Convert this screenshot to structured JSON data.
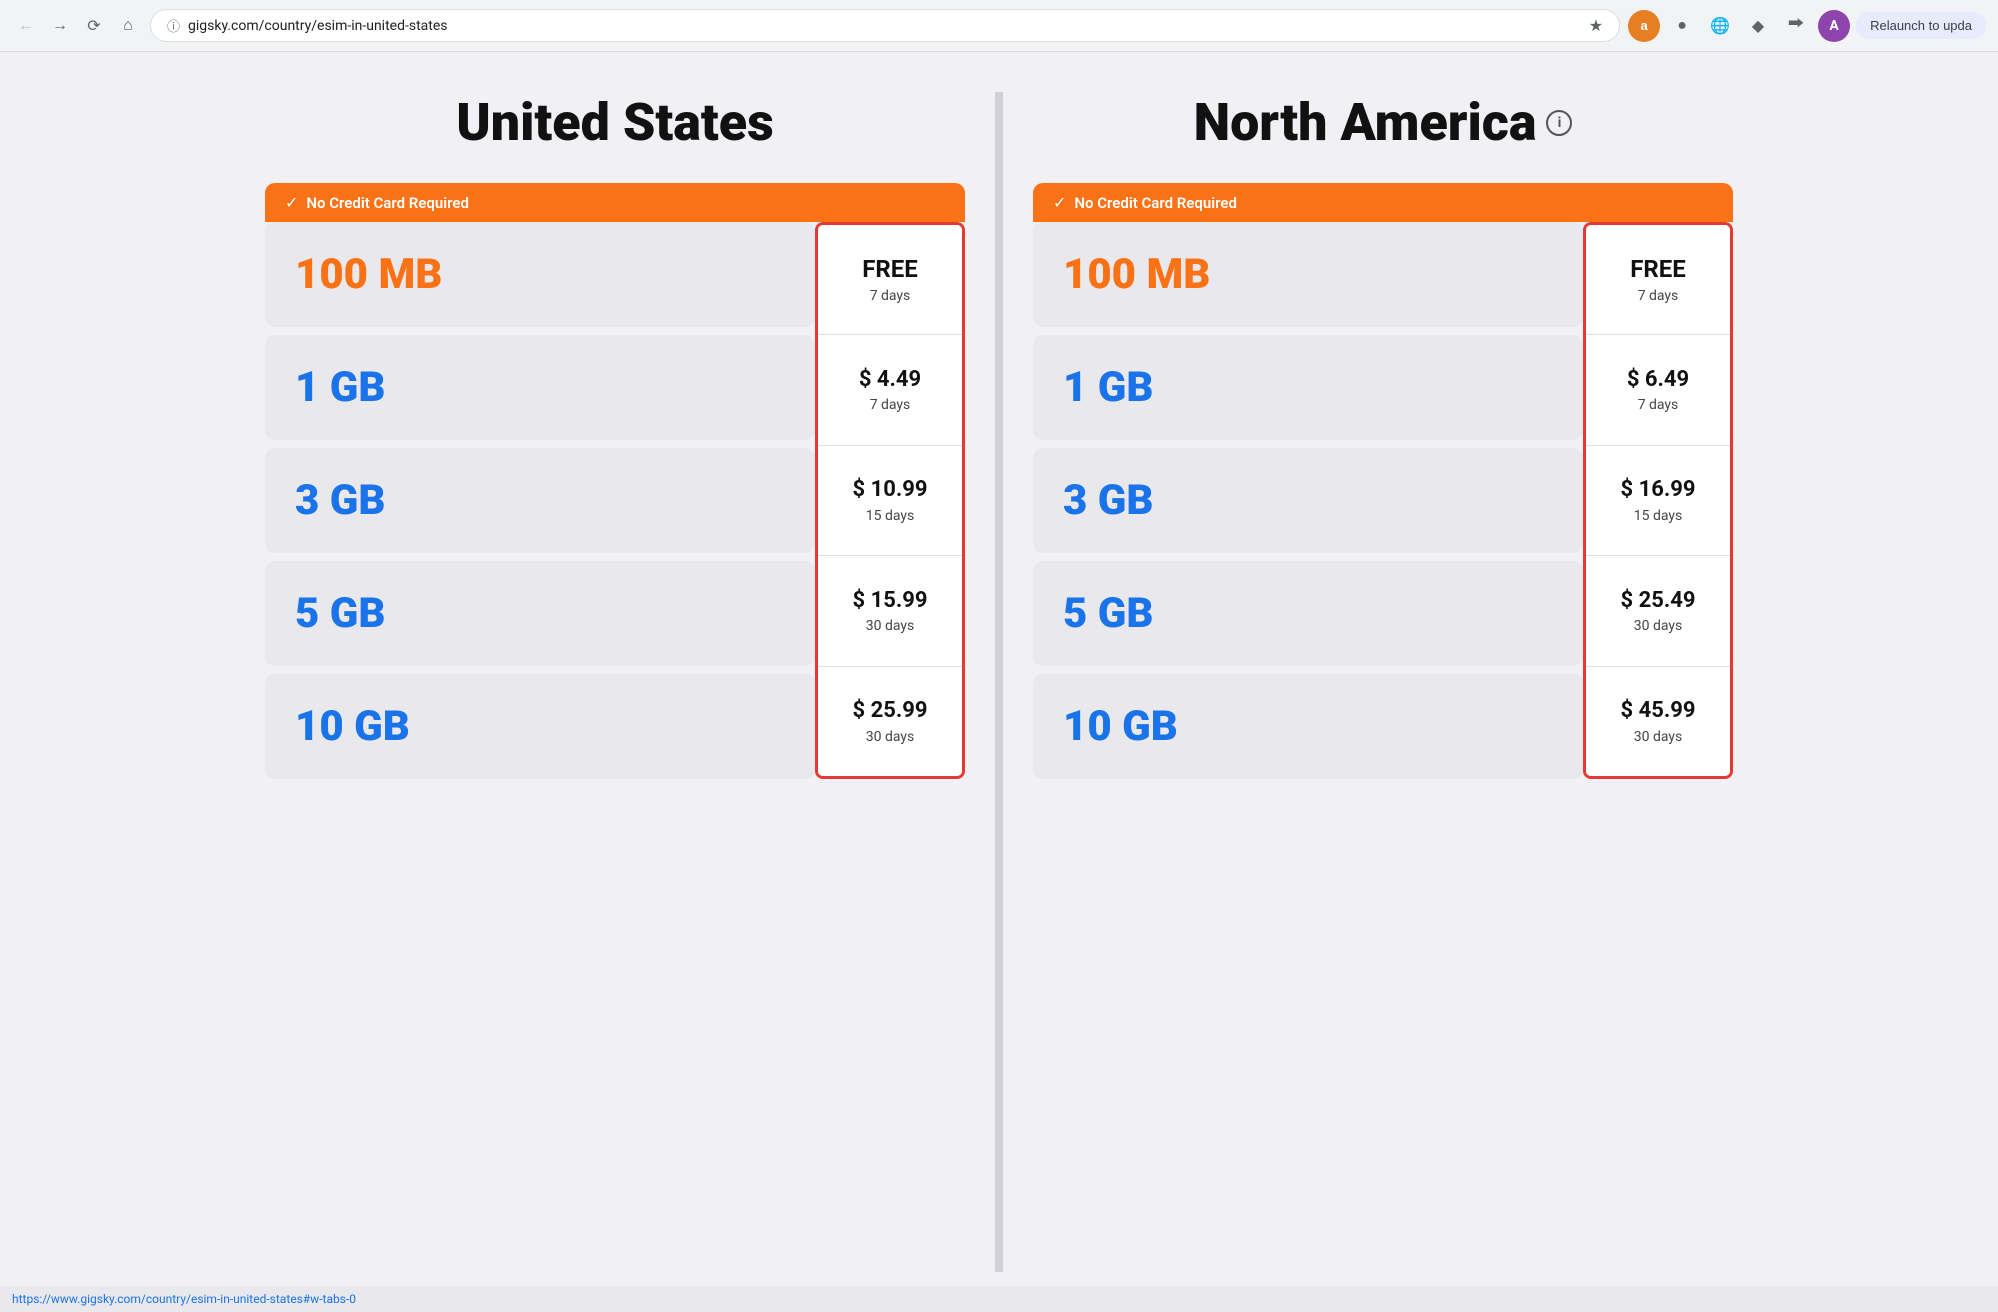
{
  "browser": {
    "url": "gigsky.com/country/esim-in-united-states",
    "relaunch_label": "Relaunch to upda",
    "avatar_letter": "A",
    "status_url": "https://www.gigsky.com/country/esim-in-united-states#w-tabs-0"
  },
  "sections": [
    {
      "id": "us",
      "title": "United States",
      "show_info": false,
      "no_credit_card": "No Credit Card Required",
      "plans": [
        {
          "data": "100 MB",
          "data_color": "orange",
          "price": "FREE",
          "days": "7 days",
          "is_free": true
        },
        {
          "data": "1 GB",
          "data_color": "blue",
          "price": "$ 4.49",
          "days": "7 days",
          "is_free": false
        },
        {
          "data": "3 GB",
          "data_color": "blue",
          "price": "$ 10.99",
          "days": "15 days",
          "is_free": false
        },
        {
          "data": "5 GB",
          "data_color": "blue",
          "price": "$ 15.99",
          "days": "30 days",
          "is_free": false
        },
        {
          "data": "10 GB",
          "data_color": "blue",
          "price": "$ 25.99",
          "days": "30 days",
          "is_free": false
        }
      ]
    },
    {
      "id": "na",
      "title": "North America",
      "show_info": true,
      "no_credit_card": "No Credit Card Required",
      "plans": [
        {
          "data": "100 MB",
          "data_color": "orange",
          "price": "FREE",
          "days": "7 days",
          "is_free": true
        },
        {
          "data": "1 GB",
          "data_color": "blue",
          "price": "$ 6.49",
          "days": "7 days",
          "is_free": false
        },
        {
          "data": "3 GB",
          "data_color": "blue",
          "price": "$ 16.99",
          "days": "15 days",
          "is_free": false
        },
        {
          "data": "5 GB",
          "data_color": "blue",
          "price": "$ 25.49",
          "days": "30 days",
          "is_free": false
        },
        {
          "data": "10 GB",
          "data_color": "blue",
          "price": "$ 45.99",
          "days": "30 days",
          "is_free": false
        }
      ]
    }
  ]
}
